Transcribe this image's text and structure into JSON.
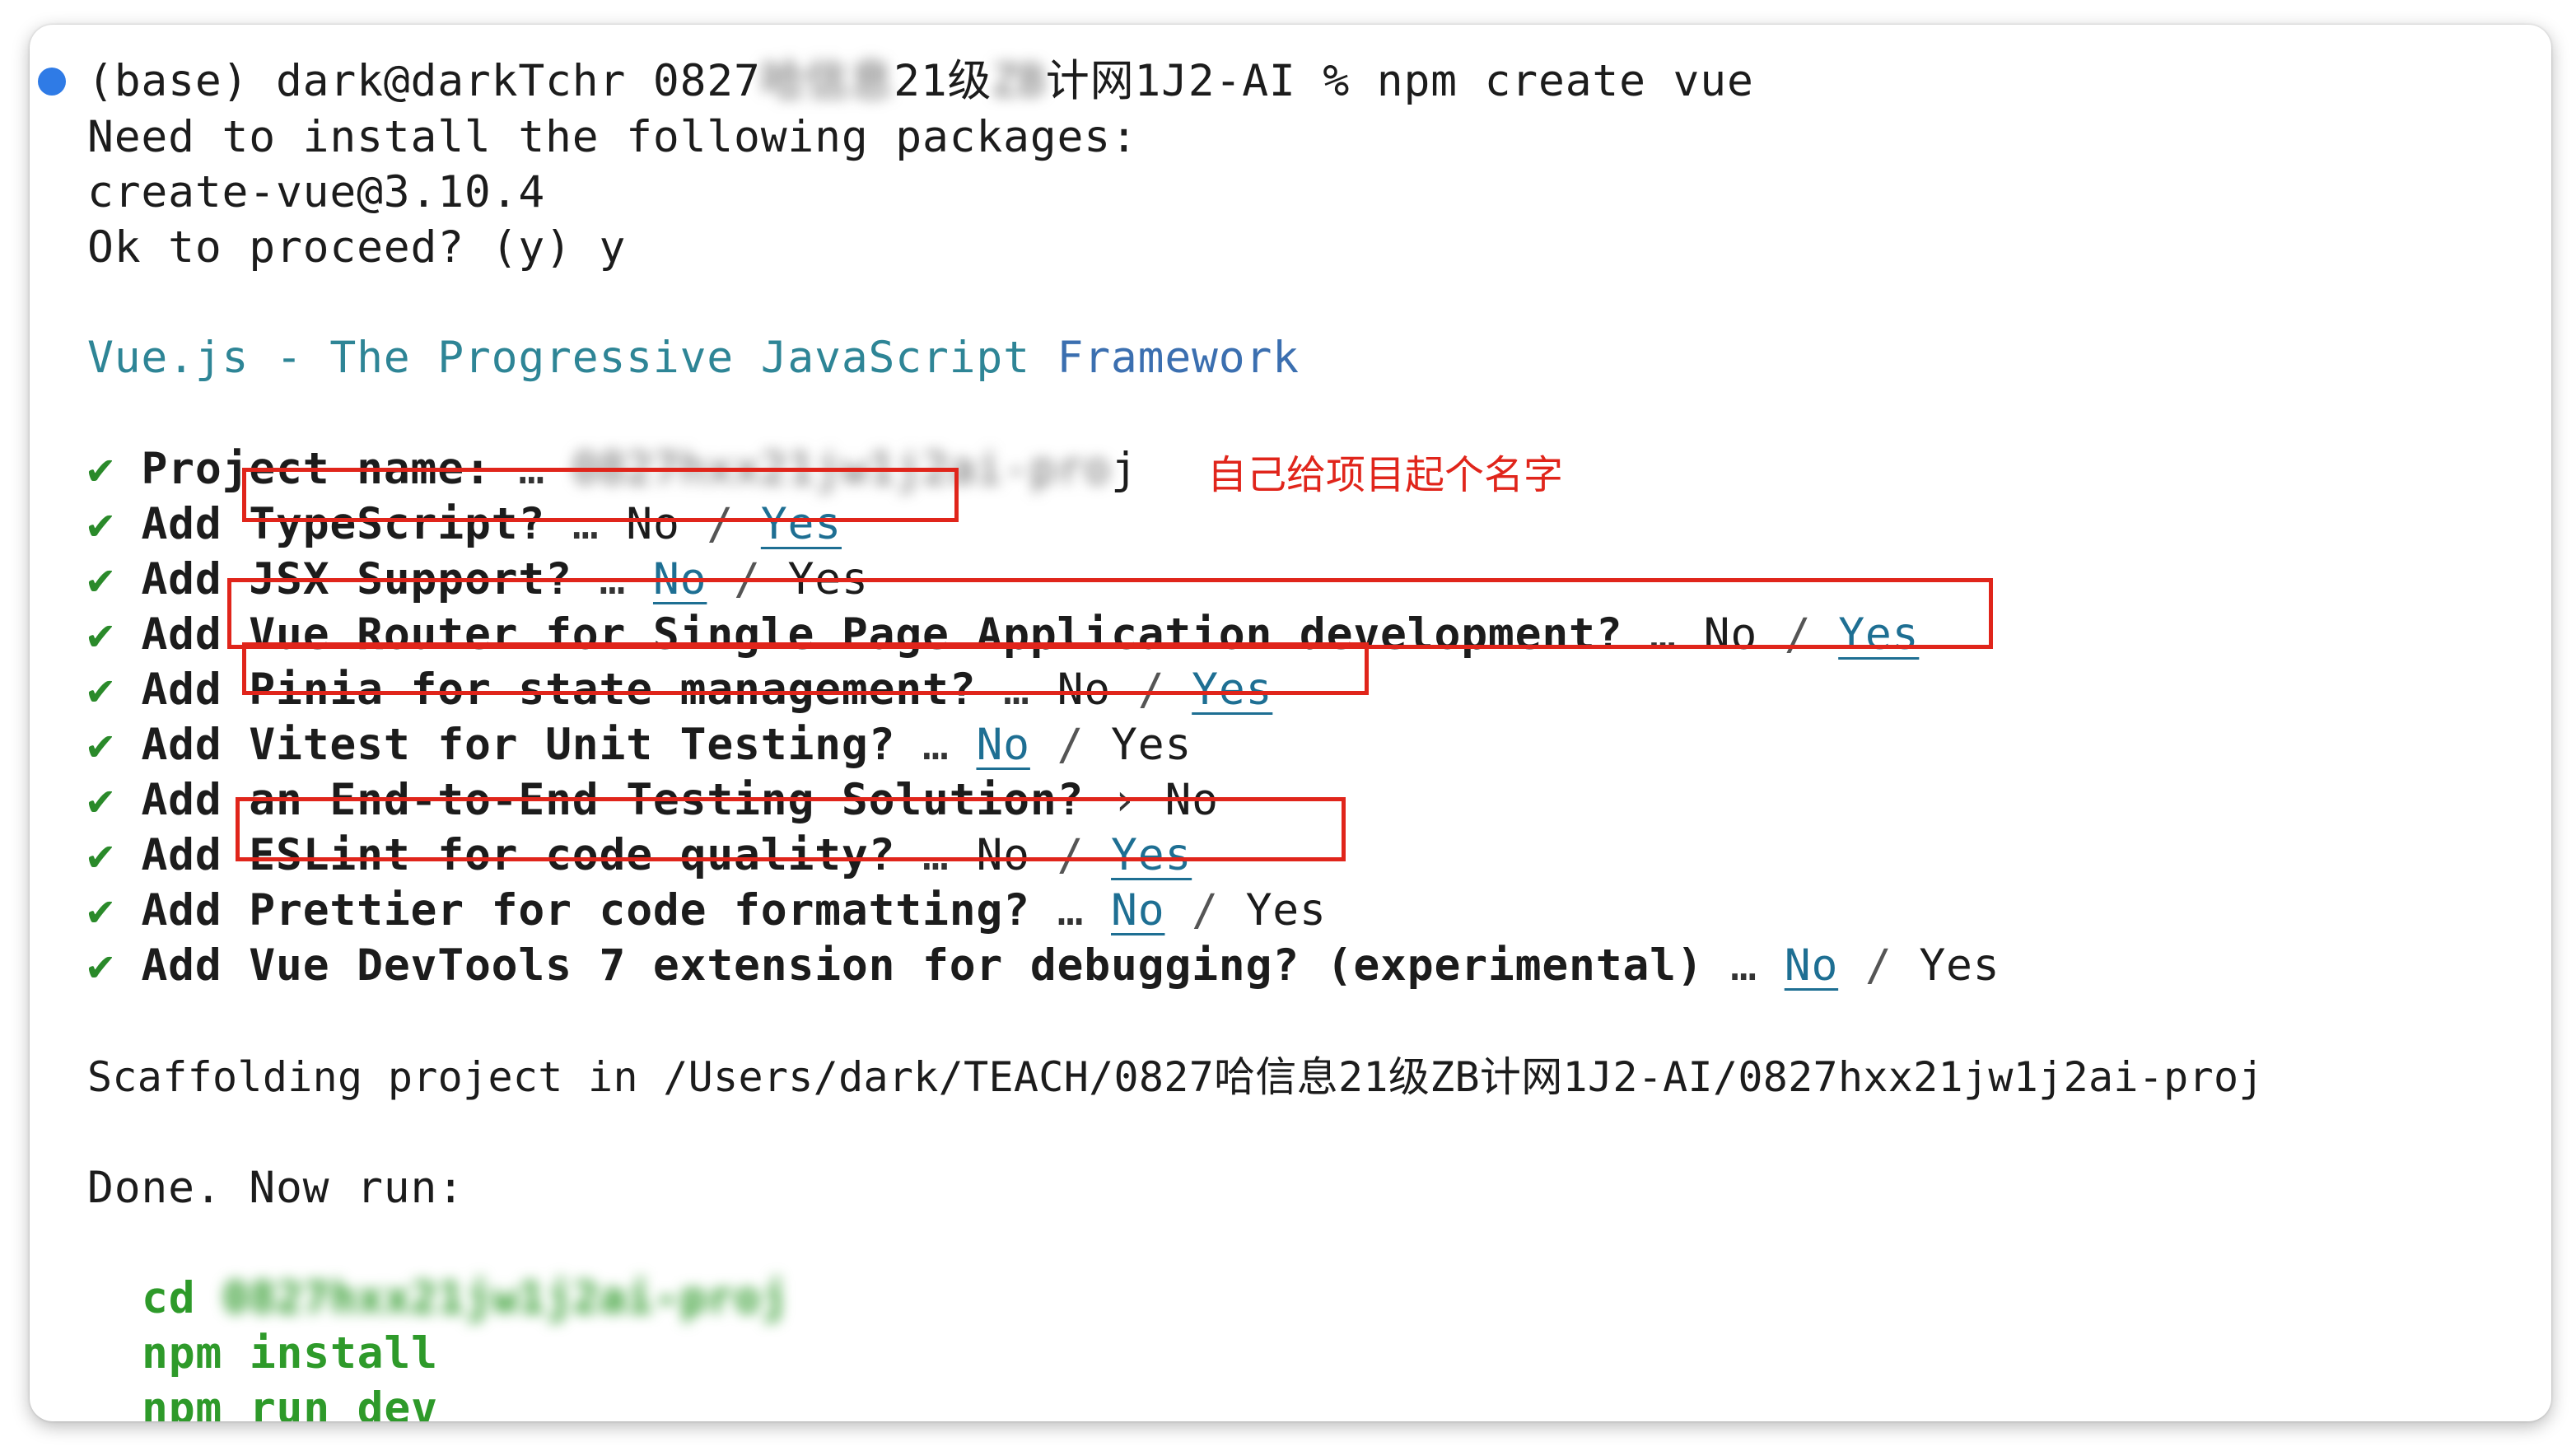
{
  "terminal": {
    "prompt_prefix": "(base) dark@darkTchr 0827",
    "prompt_blurred": "哈信息",
    "prompt_mid": "21级",
    "prompt_blurred2": "ZB",
    "prompt_suffix": "计网1J2-AI % npm create vue",
    "install_notice": "Need to install the following packages:",
    "package": "create-vue@3.10.4",
    "proceed": "Ok to proceed? (y) y",
    "banner_prefix": "Vue.js - The Progressive JavaScript ",
    "banner_suffix": "Framework"
  },
  "questions": [
    {
      "check": "✔",
      "prefix": "Project name:",
      "ellipsis": "…",
      "answer_blurred": "0827hxx21jw1j2ai-pro",
      "answer_tail": "j"
    },
    {
      "check": "✔",
      "add": "Add",
      "text": "TypeScript?",
      "ellipsis": "…",
      "opt_no": "No",
      "slash": "/",
      "opt_yes": "Yes",
      "selected": "yes"
    },
    {
      "check": "✔",
      "add": "Add",
      "text": "JSX Support?",
      "ellipsis": "…",
      "opt_no": "No",
      "slash": "/",
      "opt_yes": "Yes",
      "selected": "no"
    },
    {
      "check": "✔",
      "add": "Add",
      "text": "Vue Router for Single Page Application development?",
      "ellipsis": "…",
      "opt_no": "No",
      "slash": "/",
      "opt_yes": "Yes",
      "selected": "yes"
    },
    {
      "check": "✔",
      "add": "Add",
      "text": "Pinia for state management?",
      "ellipsis": "…",
      "opt_no": "No",
      "slash": "/",
      "opt_yes": "Yes",
      "selected": "yes"
    },
    {
      "check": "✔",
      "add": "Add",
      "text": "Vitest for Unit Testing?",
      "ellipsis": "…",
      "opt_no": "No",
      "slash": "/",
      "opt_yes": "Yes",
      "selected": "no"
    },
    {
      "check": "✔",
      "add": "Add",
      "text": "an End-to-End Testing Solution?",
      "arrow": "›",
      "answer": "No"
    },
    {
      "check": "✔",
      "add": "Add",
      "text": "ESLint for code quality?",
      "ellipsis": "…",
      "opt_no": "No",
      "slash": "/",
      "opt_yes": "Yes",
      "selected": "yes"
    },
    {
      "check": "✔",
      "add": "Add",
      "text": "Prettier for code formatting?",
      "ellipsis": "…",
      "opt_no": "No",
      "slash": "/",
      "opt_yes": "Yes",
      "selected": "no"
    },
    {
      "check": "✔",
      "add": "Add",
      "text": "Vue DevTools 7 extension for debugging? (experimental)",
      "ellipsis": "…",
      "opt_no": "No",
      "slash": "/",
      "opt_yes": "Yes",
      "selected": "no"
    }
  ],
  "annotation": "自己给项目起个名字",
  "scaffolding": "Scaffolding project in /Users/dark/TEACH/0827哈信息21级ZB计网1J2-AI/0827hxx21jw1j2ai-proj",
  "done": "Done. Now run:",
  "commands": {
    "cd_prefix": "cd ",
    "cd_blurred": "0827hxx21jw1j2ai-proj",
    "install": "npm install",
    "run_dev": "npm run dev"
  },
  "colors": {
    "highlight_box": "#e0251b",
    "selected_option": "#1e6f93",
    "command_green": "#2e9a2a",
    "banner_cyan": "#2e8596",
    "prompt_dot": "#2f7be6"
  }
}
